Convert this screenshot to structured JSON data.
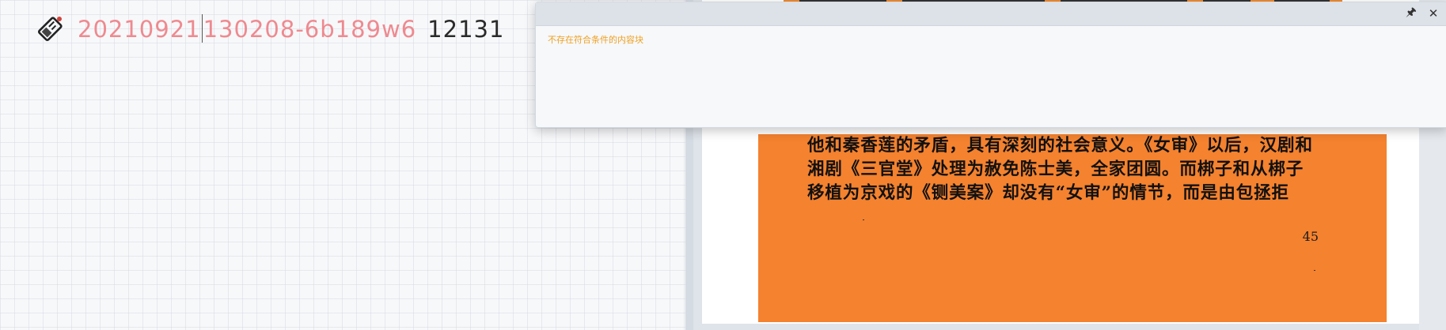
{
  "editor": {
    "doc_icon": "document-tag-icon",
    "title_highlight_before": "20210921",
    "title_highlight_after": "130208-6b189w6",
    "title_plain": "12131"
  },
  "popup": {
    "message": "不存在符合条件的内容块",
    "pin_icon": "pin-icon",
    "pin_symbol": "🖈",
    "close_icon": "close-icon",
    "close_symbol": "✕"
  },
  "preview": {
    "lines": [
      "他和秦香莲的矛盾，具有深刻的社会意义。《女审》以后，汉剧和",
      "湘剧《三官堂》处理为赦免陈士美，全家团圆。而梆子和从梆子",
      "移植为京戏的《铡美案》却没有“女审”的情节，而是由包拯拒"
    ],
    "page_number": "45",
    "page_color": "#f4822f"
  }
}
